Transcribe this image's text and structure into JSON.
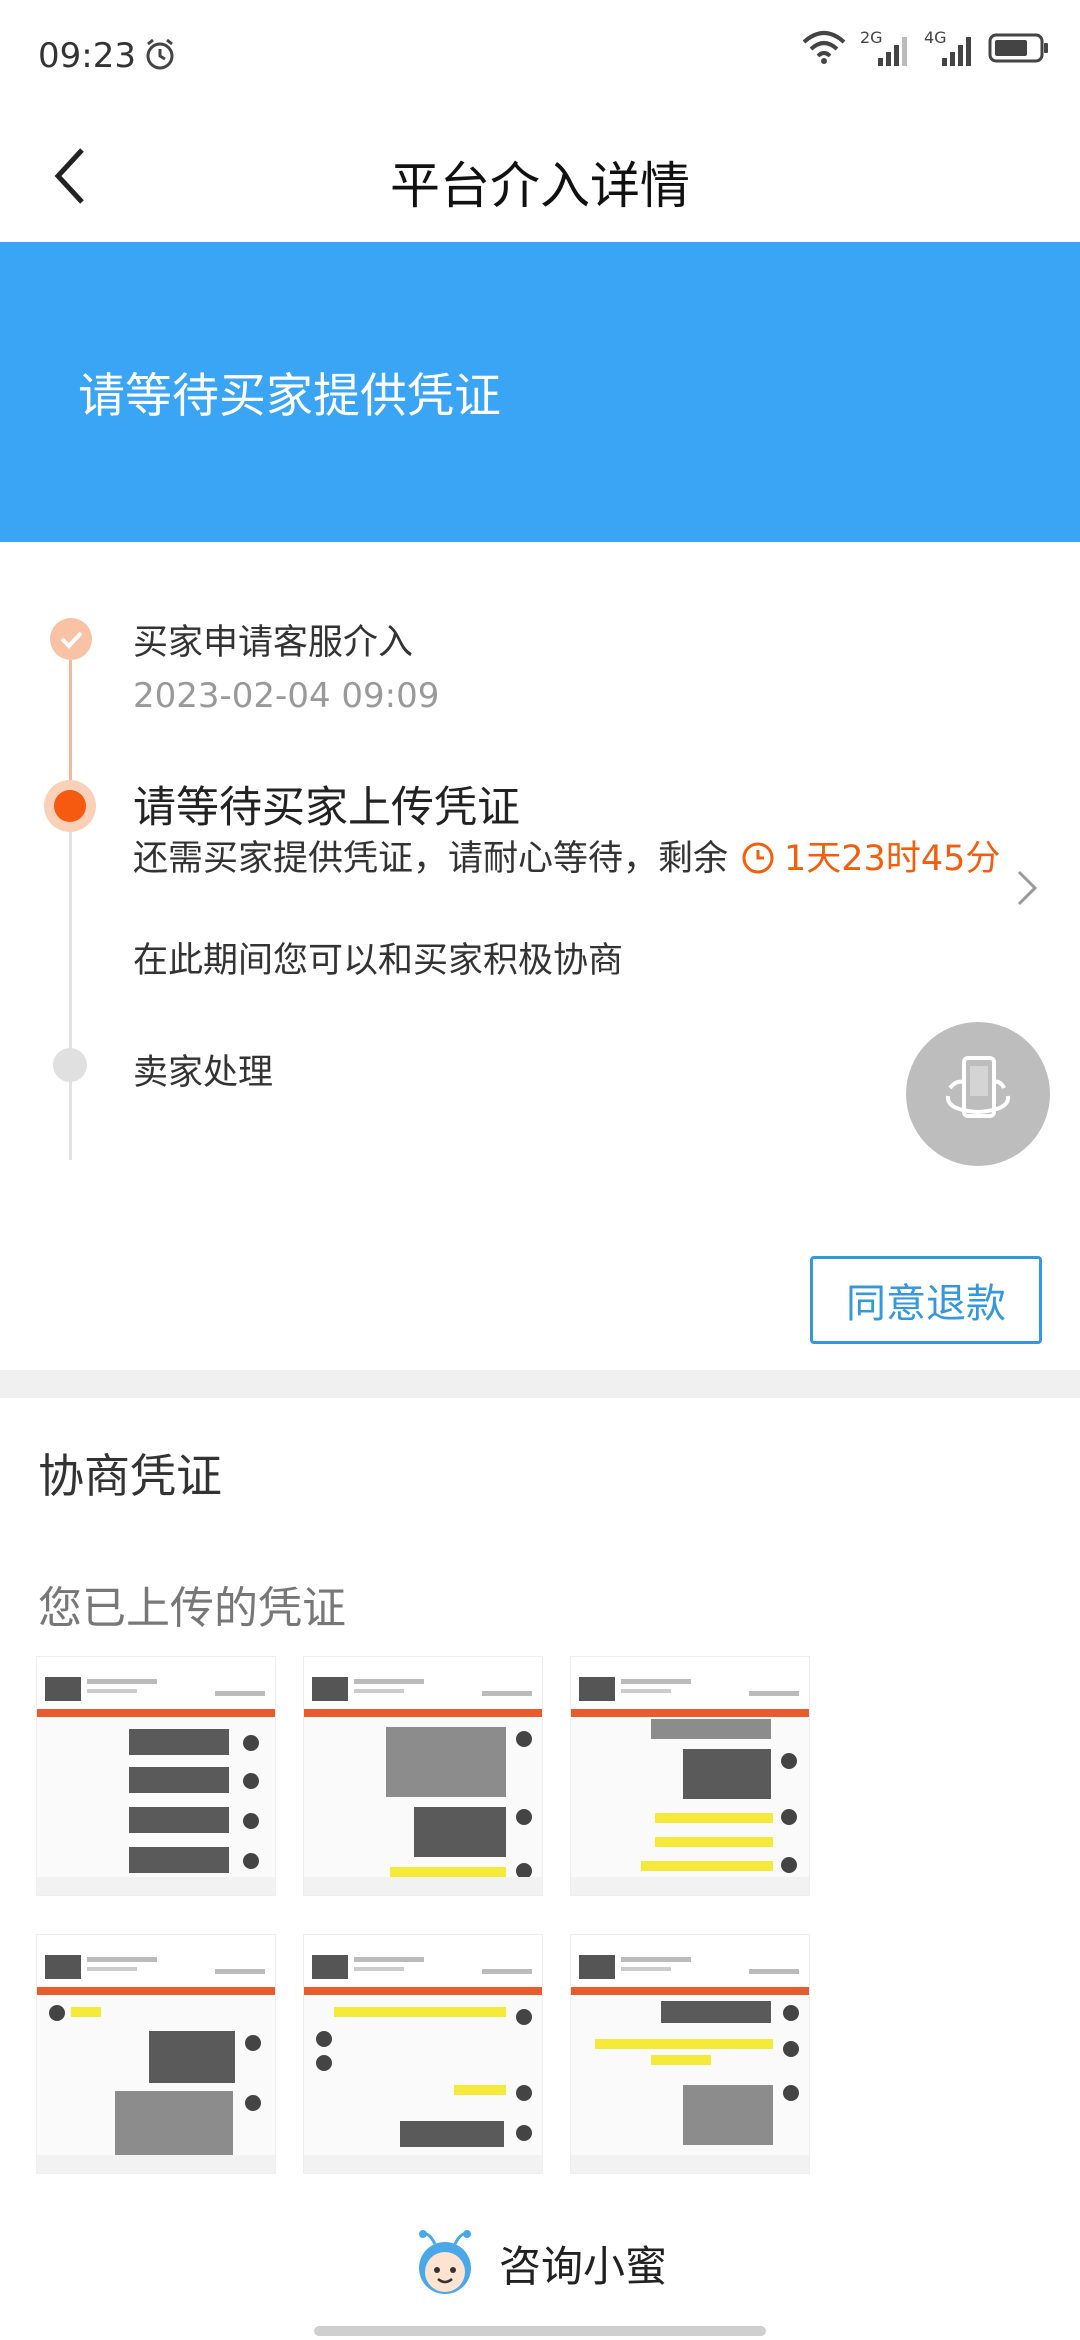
{
  "status_bar": {
    "time": "09:23",
    "net1": "2G",
    "net2": "4G",
    "icons": [
      "alarm-icon",
      "wifi-icon",
      "signal-icon",
      "battery-icon"
    ]
  },
  "header": {
    "title": "平台介入详情"
  },
  "banner": {
    "text": "请等待买家提供凭证",
    "color": "#3aa5f5"
  },
  "timeline": {
    "steps": [
      {
        "title": "买家申请客服介入",
        "time": "2023-02-04 09:09",
        "state": "done"
      },
      {
        "title": "请等待买家上传凭证",
        "desc": "还需买家提供凭证，请耐心等待，剩余",
        "countdown": "1天23时45分",
        "note": "在此期间您可以和买家积极协商",
        "state": "current"
      },
      {
        "title": "卖家处理",
        "state": "pending"
      }
    ]
  },
  "actions": {
    "agree_refund": "同意退款"
  },
  "evidence": {
    "section_title": "协商凭证",
    "uploaded_label": "您已上传的凭证",
    "images_count": 6
  },
  "footer": {
    "consult_label": "咨询小蜜"
  },
  "colors": {
    "accent_orange": "#f35e0d",
    "button_blue": "#3498db"
  }
}
